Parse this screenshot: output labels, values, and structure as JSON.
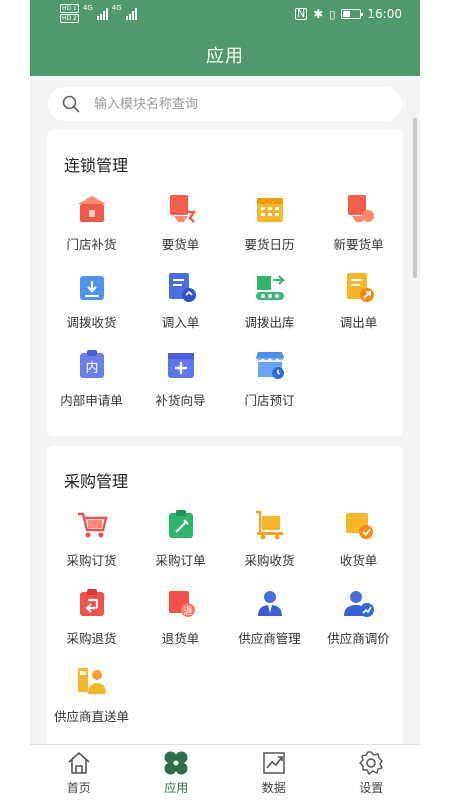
{
  "status_bar": {
    "network_hd": [
      "HD 1",
      "HD 2"
    ],
    "sig1": "4G",
    "sig2": "4G",
    "time": "16:00"
  },
  "header": {
    "title": "应用"
  },
  "search": {
    "placeholder": "输入模块名称查询",
    "value": ""
  },
  "sections": [
    {
      "title": "连锁管理",
      "items": [
        {
          "label": "门店补货",
          "icon": "store-replenish-icon"
        },
        {
          "label": "要货单",
          "icon": "request-order-icon"
        },
        {
          "label": "要货日历",
          "icon": "calendar-icon"
        },
        {
          "label": "新要货单",
          "icon": "new-request-order-icon"
        },
        {
          "label": "调拨收货",
          "icon": "transfer-receive-icon"
        },
        {
          "label": "调入单",
          "icon": "transfer-in-icon"
        },
        {
          "label": "调拨出库",
          "icon": "transfer-out-icon"
        },
        {
          "label": "调出单",
          "icon": "dispatch-order-icon"
        },
        {
          "label": "内部申请单",
          "icon": "internal-request-icon"
        },
        {
          "label": "补货向导",
          "icon": "replenish-wizard-icon"
        },
        {
          "label": "门店预订",
          "icon": "store-booking-icon"
        }
      ]
    },
    {
      "title": "采购管理",
      "items": [
        {
          "label": "采购订货",
          "icon": "purchase-cart-icon"
        },
        {
          "label": "采购订单",
          "icon": "purchase-order-icon"
        },
        {
          "label": "采购收货",
          "icon": "purchase-receive-icon"
        },
        {
          "label": "收货单",
          "icon": "receipt-icon"
        },
        {
          "label": "采购退货",
          "icon": "purchase-return-icon"
        },
        {
          "label": "退货单",
          "icon": "return-order-icon"
        },
        {
          "label": "供应商管理",
          "icon": "supplier-icon"
        },
        {
          "label": "供应商调价",
          "icon": "supplier-price-icon"
        },
        {
          "label": "供应商直送单",
          "icon": "supplier-direct-icon"
        }
      ]
    }
  ],
  "bottom_nav": [
    {
      "label": "首页",
      "icon": "home-icon",
      "active": false
    },
    {
      "label": "应用",
      "icon": "apps-icon",
      "active": true
    },
    {
      "label": "数据",
      "icon": "chart-icon",
      "active": false
    },
    {
      "label": "设置",
      "icon": "settings-icon",
      "active": false
    }
  ],
  "colors": {
    "header_green": "#4e9a6d",
    "active_nav": "#2f6e49",
    "background": "#f2f3f5"
  }
}
